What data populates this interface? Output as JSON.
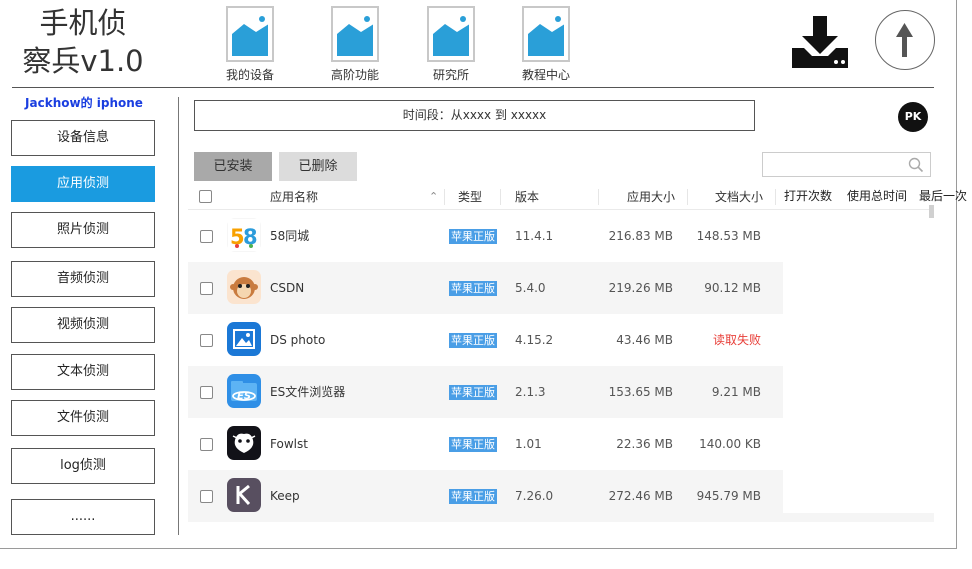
{
  "app": {
    "title_line1": "手机侦",
    "title_line2": "察兵v1.0"
  },
  "nav": [
    {
      "label": "我的设备"
    },
    {
      "label": "高阶功能"
    },
    {
      "label": "研究所"
    },
    {
      "label": "教程中心"
    }
  ],
  "device": {
    "name": "Jackhow的 iphone"
  },
  "sidebar": {
    "items": [
      {
        "label": "设备信息"
      },
      {
        "label": "应用侦测"
      },
      {
        "label": "照片侦测"
      },
      {
        "label": "音频侦测"
      },
      {
        "label": "视频侦测"
      },
      {
        "label": "文本侦测"
      },
      {
        "label": "文件侦测"
      },
      {
        "label": "log侦测"
      },
      {
        "label": "......"
      }
    ],
    "active_index": 1
  },
  "timebar": {
    "text": "时间段：从xxxx   到 xxxxx"
  },
  "pk": {
    "label": "PK"
  },
  "tabs": {
    "installed": "已安装",
    "deleted": "已删除"
  },
  "search": {
    "placeholder": ""
  },
  "table": {
    "headers": {
      "name": "应用名称",
      "type": "类型",
      "version": "版本",
      "app_size": "应用大小",
      "doc_size": "文档大小"
    },
    "extra_headers": [
      "打开次数",
      "使用总时间",
      "最后一次"
    ],
    "rows": [
      {
        "name": "58同城",
        "type": "苹果正版",
        "version": "11.4.1",
        "app_size": "216.83 MB",
        "doc_size": "148.53 MB",
        "icon": "58-icon"
      },
      {
        "name": "CSDN",
        "type": "苹果正版",
        "version": "5.4.0",
        "app_size": "219.26 MB",
        "doc_size": "90.12 MB",
        "icon": "csdn-icon"
      },
      {
        "name": "DS photo",
        "type": "苹果正版",
        "version": "4.15.2",
        "app_size": "43.46 MB",
        "doc_size": "读取失败",
        "icon": "ds-photo-icon"
      },
      {
        "name": "ES文件浏览器",
        "type": "苹果正版",
        "version": "2.1.3",
        "app_size": "153.65 MB",
        "doc_size": "9.21 MB",
        "icon": "es-file-icon"
      },
      {
        "name": "Fowlst",
        "type": "苹果正版",
        "version": "1.01",
        "app_size": "22.36 MB",
        "doc_size": "140.00 KB",
        "icon": "fowlst-icon"
      },
      {
        "name": "Keep",
        "type": "苹果正版",
        "version": "7.26.0",
        "app_size": "272.46 MB",
        "doc_size": "945.79 MB",
        "icon": "keep-icon"
      }
    ]
  },
  "colors": {
    "accent": "#1a9be0",
    "badge": "#4a9ee6",
    "error": "#e8403a",
    "device_name": "#1a3ee0"
  }
}
